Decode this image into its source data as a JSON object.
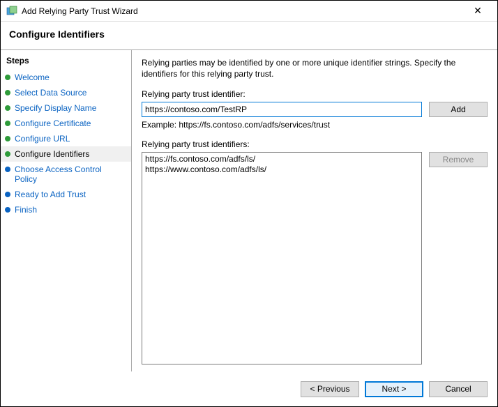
{
  "window": {
    "title": "Add Relying Party Trust Wizard",
    "close_glyph": "✕"
  },
  "subtitle": "Configure Identifiers",
  "sidebar": {
    "header": "Steps",
    "items": [
      {
        "label": "Welcome",
        "state": "done"
      },
      {
        "label": "Select Data Source",
        "state": "done"
      },
      {
        "label": "Specify Display Name",
        "state": "done"
      },
      {
        "label": "Configure Certificate",
        "state": "done"
      },
      {
        "label": "Configure URL",
        "state": "done"
      },
      {
        "label": "Configure Identifiers",
        "state": "current"
      },
      {
        "label": "Choose Access Control Policy",
        "state": "pending"
      },
      {
        "label": "Ready to Add Trust",
        "state": "pending"
      },
      {
        "label": "Finish",
        "state": "pending"
      }
    ]
  },
  "main": {
    "description": "Relying parties may be identified by one or more unique identifier strings. Specify the identifiers for this relying party trust.",
    "identifier_label": "Relying party trust identifier:",
    "identifier_value": "https://contoso.com/TestRP",
    "add_label": "Add",
    "example": "Example: https://fs.contoso.com/adfs/services/trust",
    "list_label": "Relying party trust identifiers:",
    "list_items": [
      "https://fs.contoso.com/adfs/ls/",
      "https://www.contoso.com/adfs/ls/"
    ],
    "remove_label": "Remove",
    "remove_enabled": false
  },
  "footer": {
    "previous": "< Previous",
    "next": "Next >",
    "cancel": "Cancel"
  }
}
